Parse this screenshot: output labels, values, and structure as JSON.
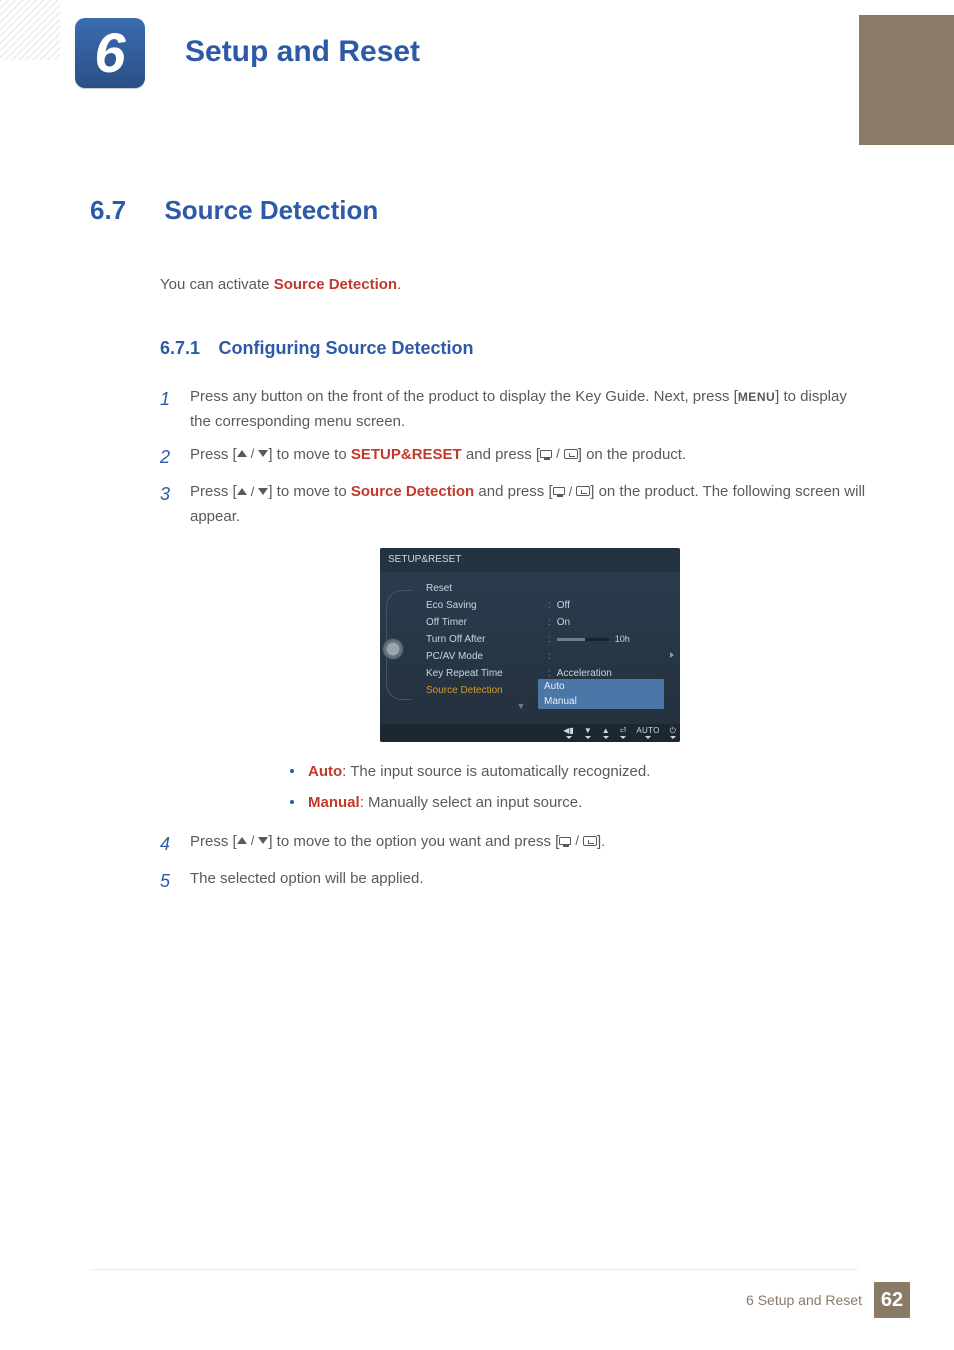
{
  "chapter": {
    "number": "6",
    "title": "Setup and Reset"
  },
  "section": {
    "number": "6.7",
    "title": "Source Detection"
  },
  "intro": {
    "pre": "You can activate ",
    "hl": "Source Detection",
    "post": "."
  },
  "subsection": {
    "number": "6.7.1",
    "title": "Configuring Source Detection"
  },
  "steps": {
    "s1": {
      "n": "1",
      "pre": "Press any button on the front of the product to display the Key Guide. Next, press [",
      "menu": "MENU",
      "post": "] to display the corresponding menu screen."
    },
    "s2": {
      "n": "2",
      "pre": "Press [",
      "mid1": "] to move to ",
      "hl": "SETUP&RESET",
      "mid2": " and press [",
      "post": "] on the product."
    },
    "s3": {
      "n": "3",
      "pre": "Press [",
      "mid1": "] to move to ",
      "hl": "Source Detection",
      "mid2": " and press [",
      "post": "] on the product. The following screen will appear."
    },
    "s4": {
      "n": "4",
      "pre": "Press [",
      "mid1": "] to move to the option you want and press [",
      "post": "]."
    },
    "s5": {
      "n": "5",
      "body": "The selected option will be applied."
    }
  },
  "bullets": {
    "auto": {
      "label": "Auto",
      "sep": ": ",
      "desc": "The input source is automatically recognized."
    },
    "manual": {
      "label": "Manual",
      "sep": ": ",
      "desc": "Manually select an input source."
    }
  },
  "osd": {
    "title": "SETUP&RESET",
    "rows": {
      "reset": "Reset",
      "eco": "Eco Saving",
      "offtimer": "Off Timer",
      "turnoff": "Turn Off After",
      "pcav": "PC/AV Mode",
      "keyrep": "Key Repeat Time",
      "srcdet": "Source Detection"
    },
    "vals": {
      "eco": "Off",
      "offtimer": "On",
      "turnoff": "10h",
      "keyrep": "Acceleration",
      "opt_auto": "Auto",
      "opt_manual": "Manual"
    },
    "nav": {
      "auto": "AUTO"
    }
  },
  "footer": {
    "text": "6 Setup and Reset",
    "page": "62"
  }
}
